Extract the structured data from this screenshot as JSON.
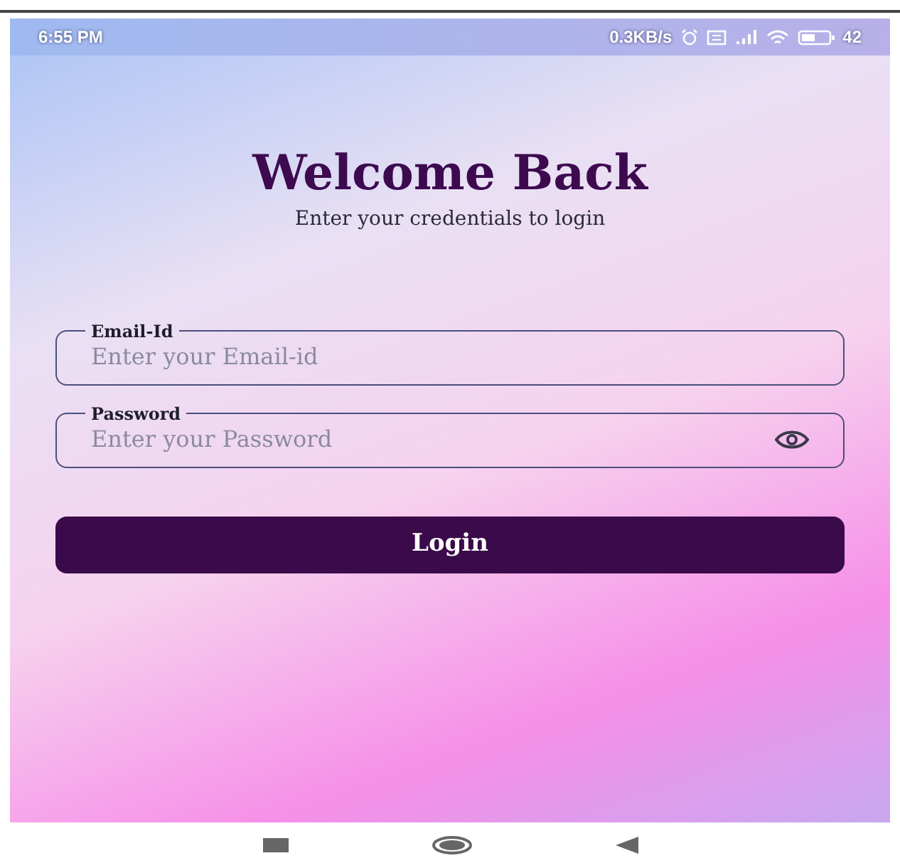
{
  "status_bar": {
    "time": "6:55 PM",
    "net_speed": "0.3KB/s",
    "battery": "42"
  },
  "title": "Welcome Back",
  "subtitle": "Enter your credentials to login",
  "fields": [
    {
      "kind": "text",
      "label": "Email-Id",
      "placeholder": "Enter your Email-id"
    },
    {
      "kind": "password",
      "label": "Password",
      "placeholder": "Enter your Password"
    }
  ],
  "login_button": "Login"
}
